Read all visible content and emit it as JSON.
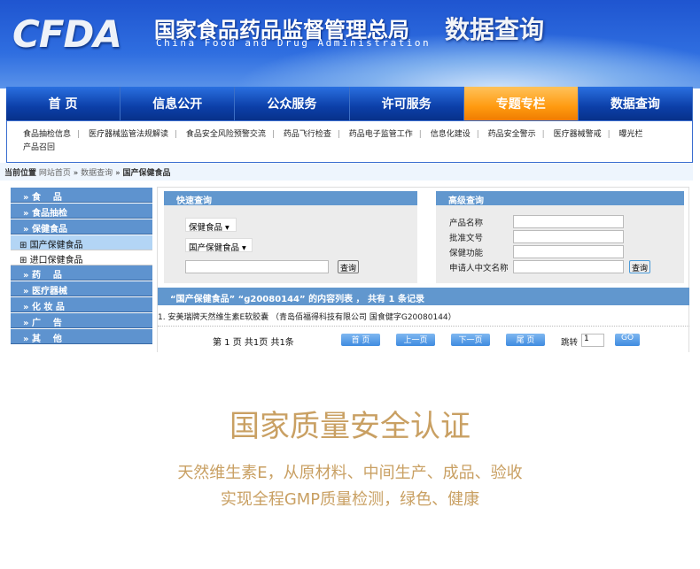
{
  "header": {
    "logo": "CFDA",
    "title_cn": "国家食品药品监督管理总局",
    "title_en": "China Food and Drug Administration",
    "page_name": "数据查询"
  },
  "nav": {
    "items": [
      "首 页",
      "信息公开",
      "公众服务",
      "许可服务",
      "专题专栏",
      "数据查询"
    ],
    "active": "专题专栏"
  },
  "subnav": {
    "items": [
      "食品抽检信息",
      "医疗器械监管法规解读",
      "食品安全风险预警交流",
      "药品飞行检查",
      "药品电子监管工作",
      "信息化建设",
      "药品安全警示",
      "医疗器械警戒",
      "曝光栏",
      "产品召回"
    ]
  },
  "breadcrumb": {
    "label": "当前位置",
    "items": [
      "网站首页",
      "数据查询",
      "国产保健食品"
    ],
    "sep": "»"
  },
  "sidebar": {
    "items": [
      {
        "label": "食    品"
      },
      {
        "label": "食品抽检"
      },
      {
        "label": "保健食品"
      },
      {
        "label": "国产保健食品",
        "sub": true,
        "selected": true
      },
      {
        "label": "进口保健食品",
        "sub": true
      },
      {
        "label": "药    品"
      },
      {
        "label": "医疗器械"
      },
      {
        "label": "化 妆 品"
      },
      {
        "label": "广    告"
      },
      {
        "label": "其    他"
      }
    ]
  },
  "quick": {
    "title": "快速查询",
    "select1": "保健食品",
    "select2": "国产保健食品",
    "input": "",
    "button": "查询"
  },
  "advanced": {
    "title": "高级查询",
    "fields": [
      "产品名称",
      "批准文号",
      "保健功能",
      "申请人中文名称"
    ],
    "button": "查询"
  },
  "results": {
    "header": "“国产保健食品” “g20080144” 的内容列表 ，  共有 1 条记录",
    "rows": [
      "1. 安美瑞牌天然维生素E软胶囊 （青岛佰福得科技有限公司 国食健字G20080144）"
    ]
  },
  "pager": {
    "text": "第 1 页 共1页 共1条",
    "buttons": [
      "首 页",
      "上一页",
      "下一页",
      "尾 页"
    ],
    "jump_label": "跳转",
    "page_value": "1",
    "go": "GO"
  },
  "promo": {
    "title": "国家质量安全认证",
    "line1": "天然维生素E，从原材料、中间生产、成品、验收",
    "line2": "实现全程GMP质量检测，绿色、健康"
  },
  "colors": {
    "nav": "#0c3fa8",
    "active_tab": "#ff9a10",
    "panel_head": "#6197ce",
    "gold": "#c9a063"
  }
}
